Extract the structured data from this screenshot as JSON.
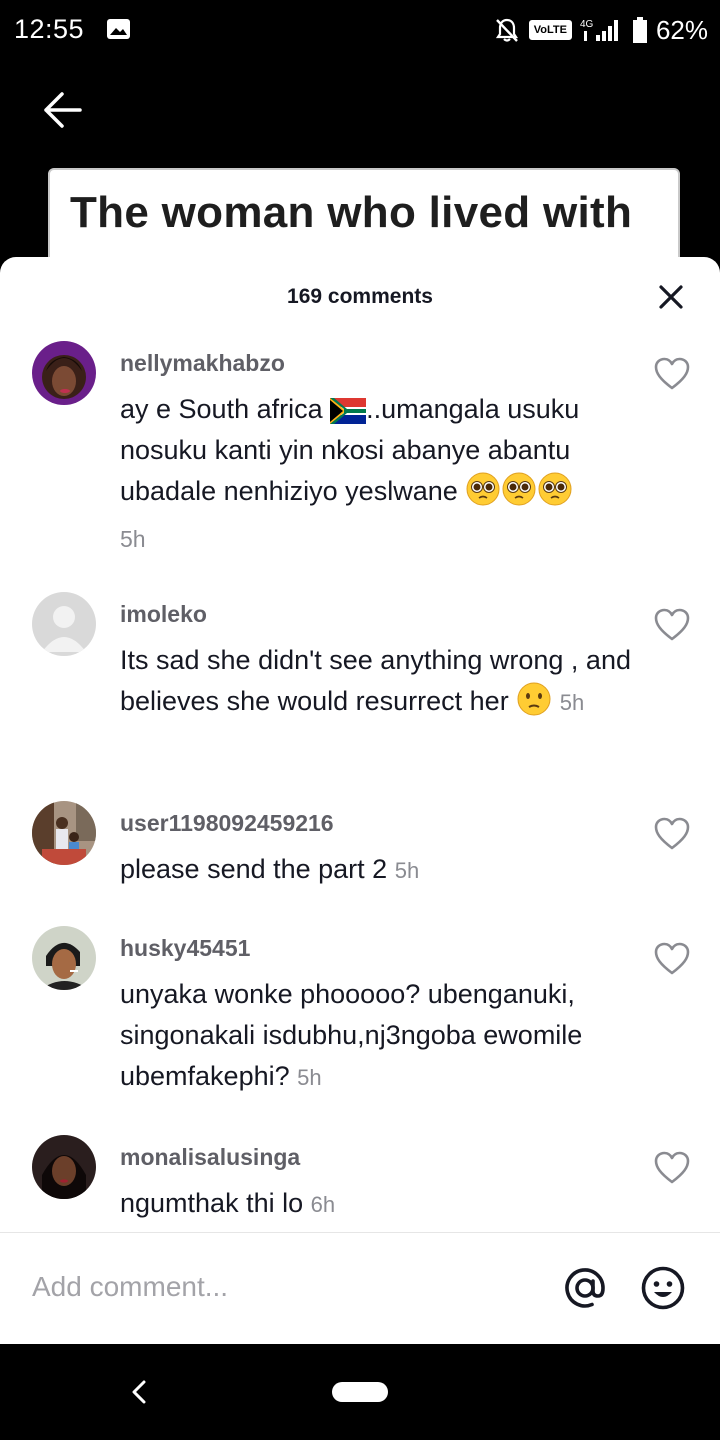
{
  "status_bar": {
    "time": "12:55",
    "volte": "VoLTE",
    "network": "4G",
    "battery": "62%",
    "icons": [
      "image-icon",
      "bell-off-icon",
      "signal-icon",
      "battery-icon"
    ]
  },
  "video": {
    "caption": "The woman who lived with"
  },
  "sheet": {
    "comments_count": "169 comments"
  },
  "comments": [
    {
      "user": "nellymakhabzo",
      "text_parts": [
        "ay e South africa ",
        "..umangala usuku nosuku kanti yin nkosi abanye abantu ubadale nenhiziyo yeslwane "
      ],
      "emoji": [
        "south-africa-flag-emoji",
        "pleading-face-emoji",
        "pleading-face-emoji",
        "pleading-face-emoji"
      ],
      "time": "5h"
    },
    {
      "user": "imoleko",
      "text": "Its sad she didn't see anything wrong , and believes she would resurrect her",
      "emoji": [
        "hushed-face-emoji"
      ],
      "time": "5h"
    },
    {
      "user": "user1198092459216",
      "text": "please send the part 2",
      "time": "5h"
    },
    {
      "user": "husky45451",
      "text": "unyaka wonke phooooo? ubenganuki, singonakali isdubhu,nj3ngoba ewomile ubemfakephi?",
      "time": "5h"
    },
    {
      "user": "monalisalusinga",
      "text": "ngumthak thi lo",
      "time": "6h"
    }
  ],
  "input": {
    "placeholder": "Add comment..."
  },
  "colors": {
    "sheet_bg": "#ffffff",
    "username": "#5f5f66",
    "text": "#161823",
    "muted": "#8a8b91"
  }
}
